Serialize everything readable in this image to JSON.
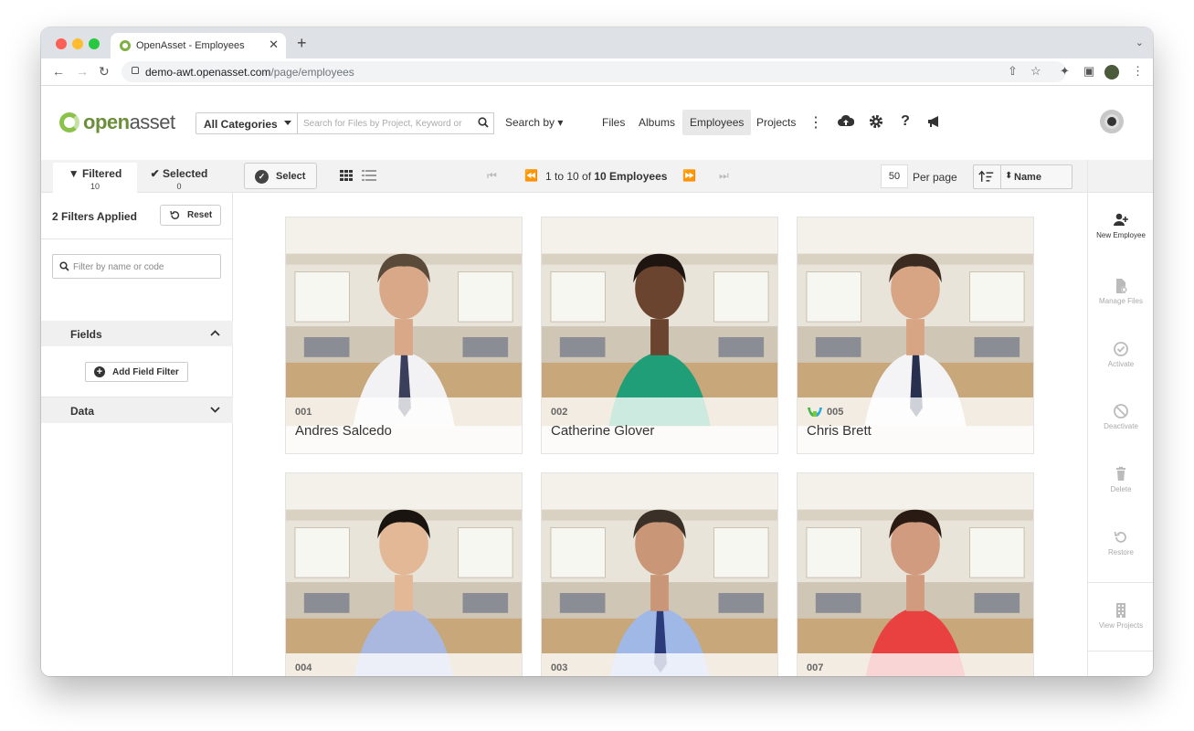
{
  "browser": {
    "tab_title": "OpenAsset - Employees",
    "tab_close": "✕",
    "new_tab": "+",
    "url_host": "demo-awt.openasset.com",
    "url_path": "/page/employees"
  },
  "app": {
    "logo_open": "open",
    "logo_asset": "asset",
    "category_select": "All Categories",
    "search_placeholder": "Search for Files by Project, Keyword or",
    "search_by": "Search by ▾",
    "nav": {
      "files": "Files",
      "albums": "Albums",
      "employees": "Employees",
      "projects": "Projects"
    }
  },
  "toolbar": {
    "filtered_label": "Filtered",
    "filtered_count": "10",
    "selected_label": "Selected",
    "selected_count": "0",
    "select_label": "Select",
    "page_prefix": "1 to 10 of ",
    "page_total": "10 Employees",
    "per_page_value": "50",
    "per_page_label": "Per page",
    "sort_label": "Name"
  },
  "sidebar": {
    "filters_applied": "2 Filters Applied",
    "reset_label": "Reset",
    "filter_placeholder": "Filter by name or code",
    "fields_label": "Fields",
    "add_field_label": "Add Field Filter",
    "data_label": "Data"
  },
  "employees": [
    {
      "code": "001",
      "name": "Andres Salcedo",
      "shirt": "#f2f2f4",
      "tie": "#3b3f5c",
      "skin": "#d8a888",
      "hair": "#5a4a3a"
    },
    {
      "code": "002",
      "name": "Catherine Glover",
      "shirt": "#1f9e77",
      "tie": "",
      "skin": "#6b4430",
      "hair": "#1e1410"
    },
    {
      "code": "005",
      "name": "Chris Brett",
      "shirt": "#f4f4f6",
      "tie": "#27304f",
      "skin": "#d8a584",
      "hair": "#3a2a20",
      "badge": true
    },
    {
      "code": "004",
      "name": "",
      "shirt": "#aab8e0",
      "tie": "",
      "skin": "#e3b897",
      "hair": "#1a1410"
    },
    {
      "code": "003",
      "name": "",
      "shirt": "#9fb8e6",
      "tie": "#2b3a7a",
      "skin": "#c99677",
      "hair": "#3a3028"
    },
    {
      "code": "007",
      "name": "",
      "shirt": "#e8413f",
      "tie": "",
      "skin": "#d09b7e",
      "hair": "#2a1a14"
    }
  ],
  "actions": {
    "new_employee": "New Employee",
    "manage_files": "Manage Files",
    "activate": "Activate",
    "deactivate": "Deactivate",
    "delete": "Delete",
    "restore": "Restore",
    "view_projects": "View Projects"
  },
  "colors": {
    "brand_green": "#8bc34a",
    "nav_active_bg": "#e8e8e8",
    "toolbar_bg": "#f2f2f2"
  }
}
